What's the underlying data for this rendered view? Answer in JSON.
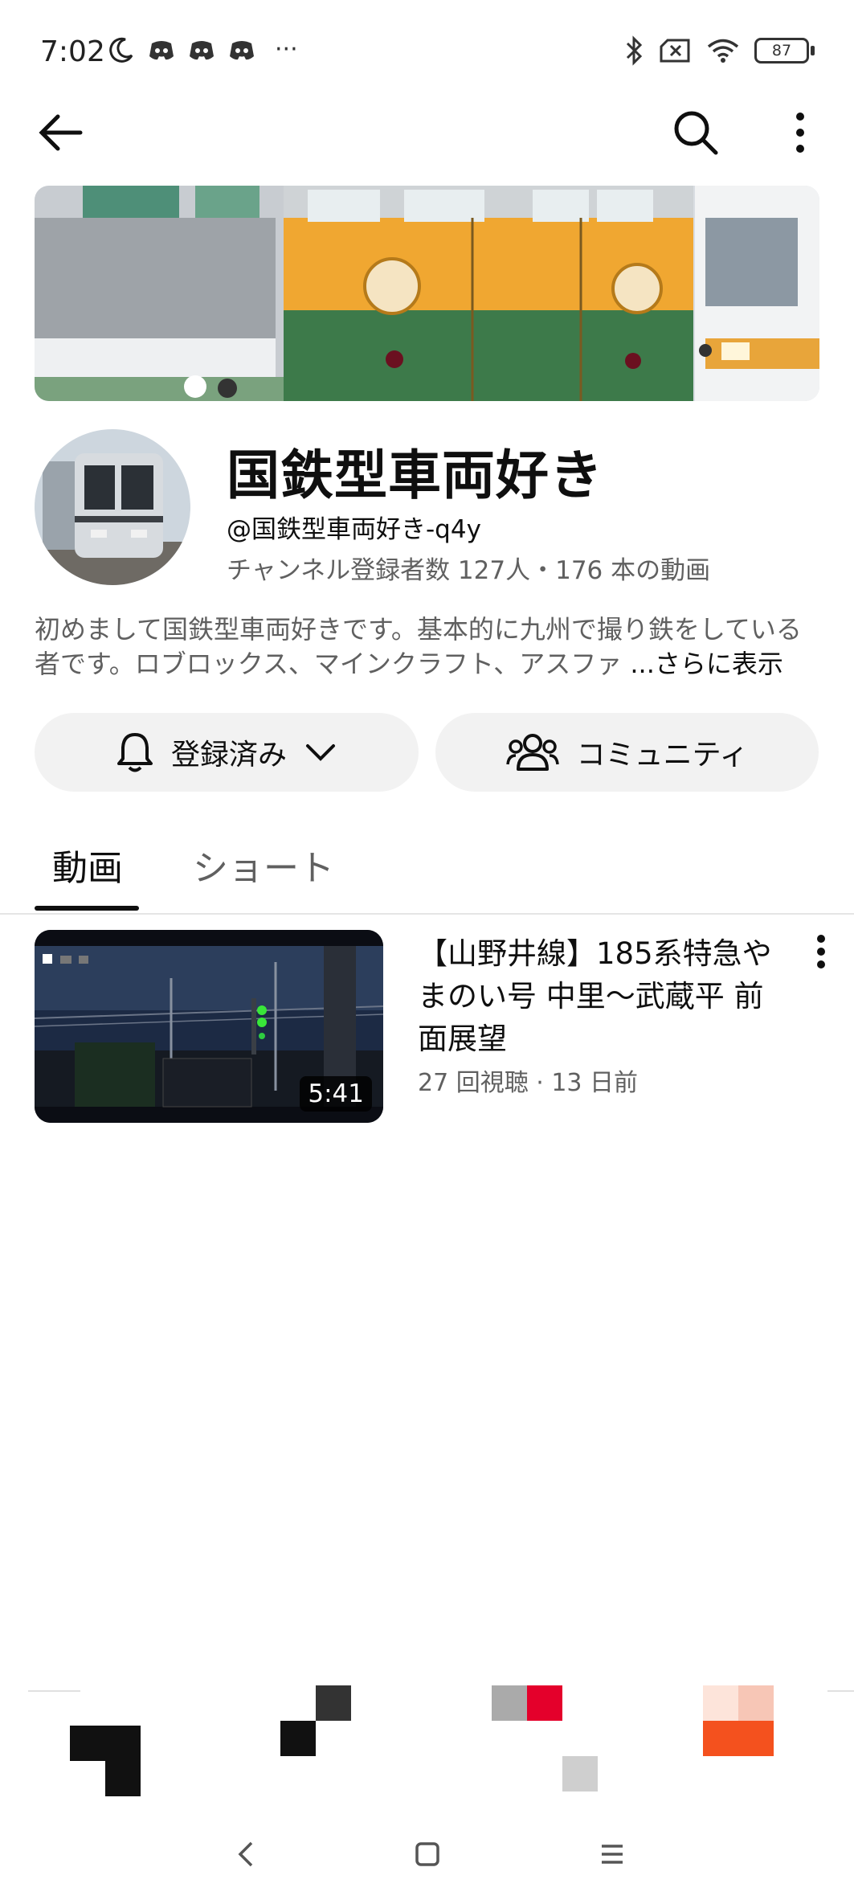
{
  "status_bar": {
    "time": "7:02",
    "left_icons": [
      "moon-icon",
      "discord-icon",
      "discord-icon",
      "discord-icon",
      "more-dots-icon"
    ],
    "more": "···",
    "battery": "87"
  },
  "channel": {
    "name": "国鉄型車両好き",
    "handle": "@国鉄型車両好き-q4y",
    "meta": "チャンネル登録者数 127人・176 本の動画",
    "description_line1": "初めまして国鉄型車両好きです。基本的に九州で撮り鉄をしている",
    "description_line2": "者です。ロブロックス、マインクラフト、アスファ",
    "more_label": "...さらに表示"
  },
  "buttons": {
    "subscribed_label": "登録済み",
    "community_label": "コミュニティ"
  },
  "tabs": [
    {
      "label": "動画",
      "active": true
    },
    {
      "label": "ショート",
      "active": false
    }
  ],
  "videos": [
    {
      "title": "【山野井線】185系特急やまのい号 中里〜武蔵平 前面展望",
      "meta": "27 回視聴 · 13 日前",
      "duration": "5:41"
    }
  ],
  "colors": {
    "accent_green": "#3f7a4a",
    "accent_orange": "#e8a53a",
    "nav_red": "#e4002b",
    "nav_orange": "#f4511e"
  }
}
